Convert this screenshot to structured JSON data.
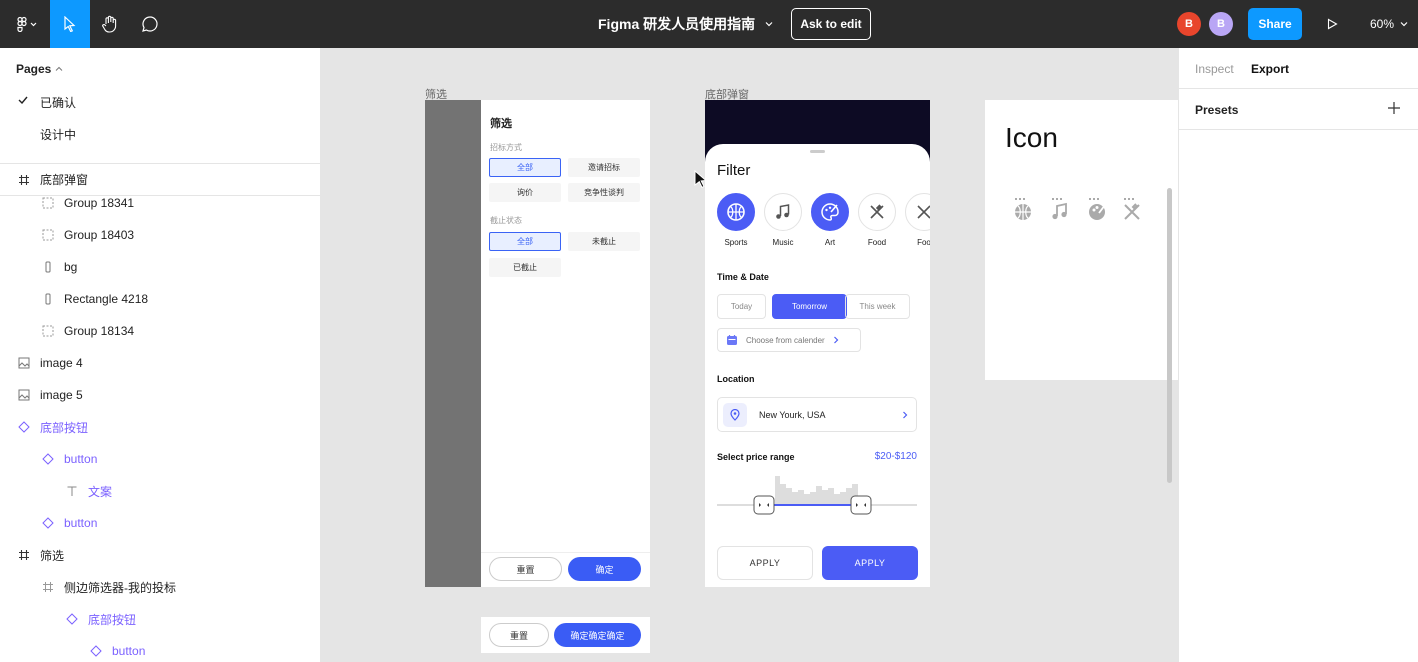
{
  "topbar": {
    "file_title": "Figma 研发人员使用指南",
    "ask_to_edit": "Ask to edit",
    "avatars": [
      {
        "initial": "B",
        "color": "#e8452c"
      },
      {
        "initial": "B",
        "color": "#b9a6f5"
      }
    ],
    "share": "Share",
    "zoom": "60%"
  },
  "left": {
    "pages_label": "Pages",
    "pages": [
      {
        "label": "已确认",
        "selected": true
      },
      {
        "label": "设计中",
        "selected": false
      }
    ],
    "layers": [
      {
        "label": "底部弹窗",
        "icon": "frame-icon",
        "indent": 0
      },
      {
        "label": "Group 18341",
        "icon": "group-icon",
        "indent": 1
      },
      {
        "label": "Group 18403",
        "icon": "group-icon",
        "indent": 1
      },
      {
        "label": "bg",
        "icon": "rectangle-icon",
        "indent": 1
      },
      {
        "label": "Rectangle 4218",
        "icon": "rectangle-icon",
        "indent": 1
      },
      {
        "label": "Group 18134",
        "icon": "group-icon",
        "indent": 1
      },
      {
        "label": "image 4",
        "icon": "image-icon",
        "indent": 0
      },
      {
        "label": "image 5",
        "icon": "image-icon",
        "indent": 0
      },
      {
        "label": "底部按钮",
        "icon": "component-icon",
        "indent": 0
      },
      {
        "label": "button",
        "icon": "component-icon",
        "indent": 1
      },
      {
        "label": "文案",
        "icon": "text-icon",
        "indent": 2
      },
      {
        "label": "button",
        "icon": "component-icon",
        "indent": 1
      },
      {
        "label": "筛选",
        "icon": "frame-icon",
        "indent": 0
      },
      {
        "label": "侧边筛选器-我的投标",
        "icon": "frame-icon",
        "indent": 1
      },
      {
        "label": "底部按钮",
        "icon": "component-icon",
        "indent": 2
      },
      {
        "label": "button",
        "icon": "component-icon",
        "indent": 3
      }
    ]
  },
  "right": {
    "tab_inspect": "Inspect",
    "tab_export": "Export",
    "presets": "Presets"
  },
  "canvas": {
    "frame1": {
      "name": "筛选",
      "title": "筛选",
      "section1": "招标方式",
      "chips1": [
        "全部",
        "邀请招标",
        "询价",
        "竞争性谈判"
      ],
      "section2": "截止状态",
      "chips2": [
        "全部",
        "未截止",
        "已截止"
      ],
      "reset": "重置",
      "confirm": "确定",
      "strip_reset": "重置",
      "strip_confirm": "确定确定确定"
    },
    "frame2": {
      "name": "底部弹窗",
      "title": "Filter",
      "categories": [
        "Sports",
        "Music",
        "Art",
        "Food",
        "Foo"
      ],
      "time_date": "Time & Date",
      "dates": [
        "Today",
        "Tomorrow",
        "This week"
      ],
      "calendar": "Choose from calender",
      "location_label": "Location",
      "location_value": "New Yourk, USA",
      "price_label": "Select price range",
      "price_value": "$20-$120",
      "apply_outline": "APPLY",
      "apply_fill": "APPLY"
    },
    "frame3": {
      "title": "Icon"
    }
  }
}
